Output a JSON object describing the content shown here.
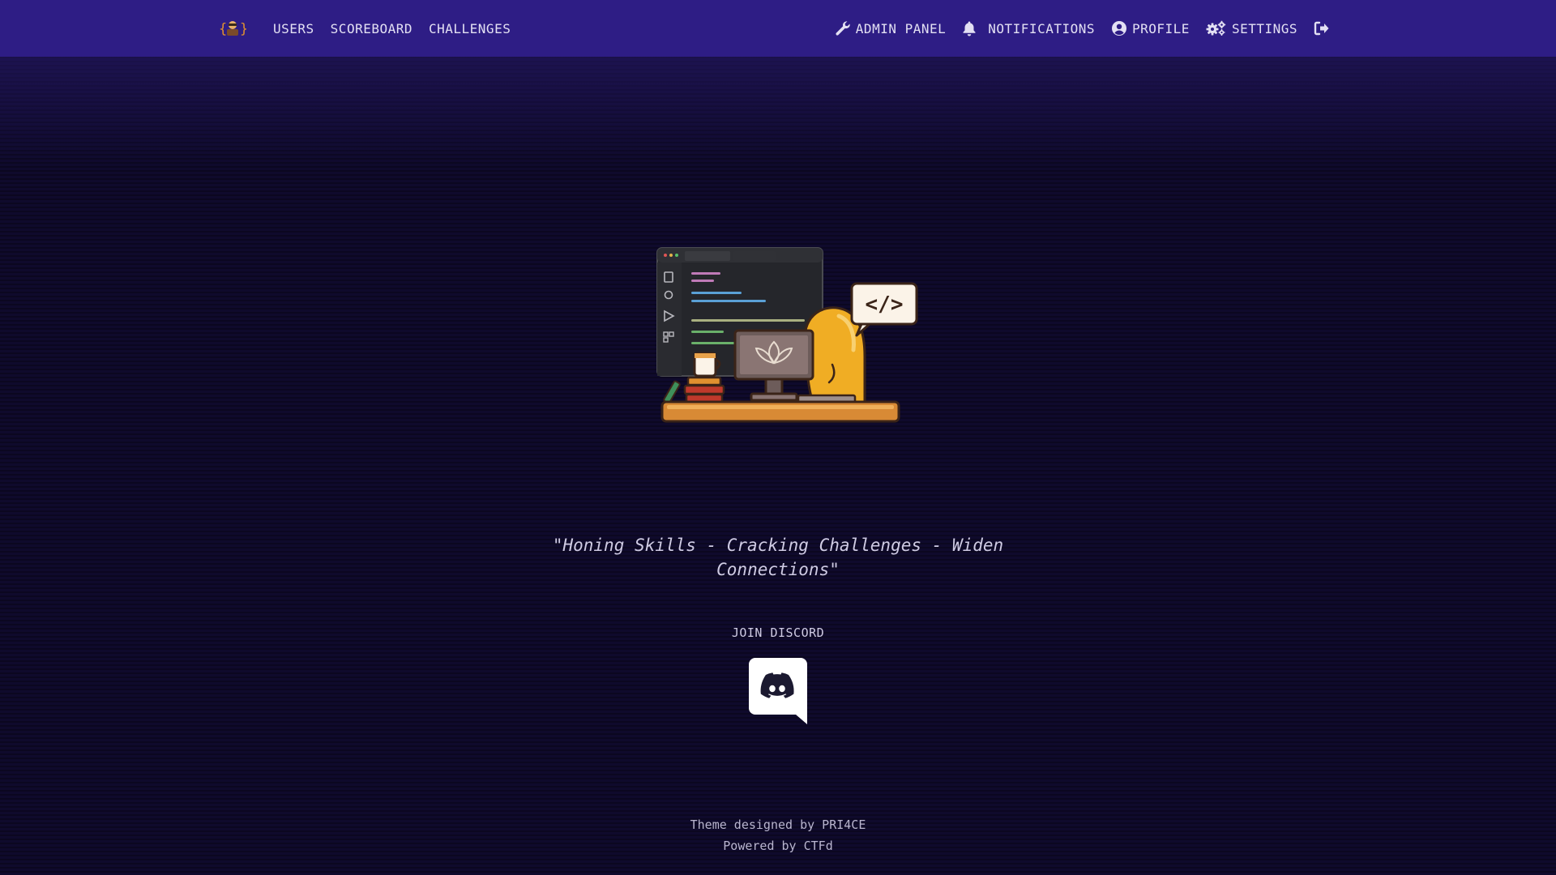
{
  "nav": {
    "brand_icon": "hacker-avatar-icon",
    "left_links": [
      {
        "label": "USERS"
      },
      {
        "label": "SCOREBOARD"
      },
      {
        "label": "CHALLENGES"
      }
    ],
    "right_links": {
      "admin": {
        "label": "ADMIN PANEL",
        "icon": "wrench-icon"
      },
      "notifications": {
        "label": "NOTIFICATIONS",
        "icon": "bell-icon"
      },
      "profile": {
        "label": "PROFILE",
        "icon": "user-circle-icon"
      },
      "settings": {
        "label": "SETTINGS",
        "icon": "gears-icon"
      },
      "logout": {
        "icon": "sign-out-icon"
      }
    }
  },
  "hero": {
    "code_bubble": "</>"
  },
  "main": {
    "tagline": "\"Honing Skills - Cracking Challenges - Widen Connections\"",
    "discord_label": "JOIN DISCORD"
  },
  "footer": {
    "line1": "Theme designed by PRI4CE",
    "line2": "Powered by CTFd"
  },
  "colors": {
    "navbar": "#2e1d85",
    "background": "#0f0a2c",
    "text": "#d6d3e6"
  }
}
